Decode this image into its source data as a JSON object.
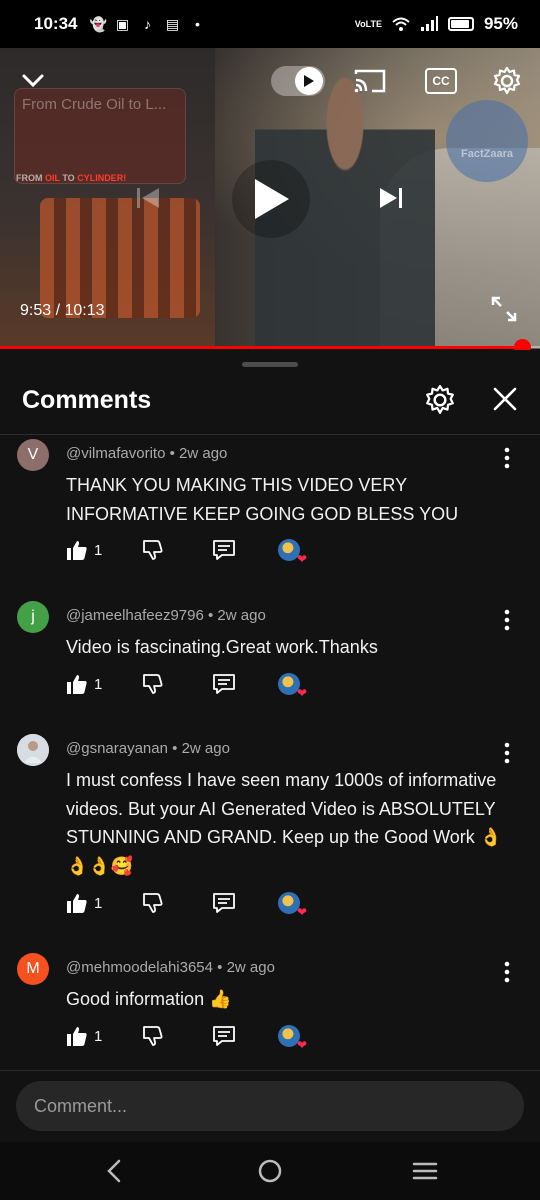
{
  "status_bar": {
    "time": "10:34",
    "battery": "95%",
    "network": "VoLTE"
  },
  "player": {
    "preview_title": "From Crude Oil to L...",
    "preview_caption_a": "FROM ",
    "preview_caption_b": "OIL",
    "preview_caption_c": " TO ",
    "preview_caption_d": "CYLINDER!",
    "watermark": "FactZaara",
    "cc_label": "CC",
    "timecode": "9:53 / 10:13",
    "progress_fraction": 0.967,
    "progress_color": "#ff0000"
  },
  "comments_panel": {
    "title": "Comments",
    "placeholder": "Comment..."
  },
  "comments": [
    {
      "avatar_letter": "V",
      "avatar_color": "#8e6e6a",
      "author": "@vilmafavorito",
      "age": "2w ago",
      "text": "THANK YOU MAKING THIS VIDEO VERY INFORMATIVE KEEP GOING GOD BLESS YOU",
      "likes": "1"
    },
    {
      "avatar_letter": "j",
      "avatar_color": "#43a047",
      "author": "@jameelhafeez9796",
      "age": "2w ago",
      "text": "Video is fascinating.Great work.Thanks",
      "likes": "1"
    },
    {
      "avatar_letter": "",
      "avatar_color": "#cfd4db",
      "author": "@gsnarayanan",
      "age": "2w ago",
      "text": "I must confess I have seen many 1000s of informative videos. But your AI Generated Video is ABSOLUTELY STUNNING AND GRAND. Keep up the Good Work 👌👌👌🥰",
      "likes": "1"
    },
    {
      "avatar_letter": "M",
      "avatar_color": "#f4511e",
      "author": "@mehmoodelahi3654",
      "age": "2w ago",
      "text": "Good information 👍",
      "likes": "1"
    }
  ]
}
